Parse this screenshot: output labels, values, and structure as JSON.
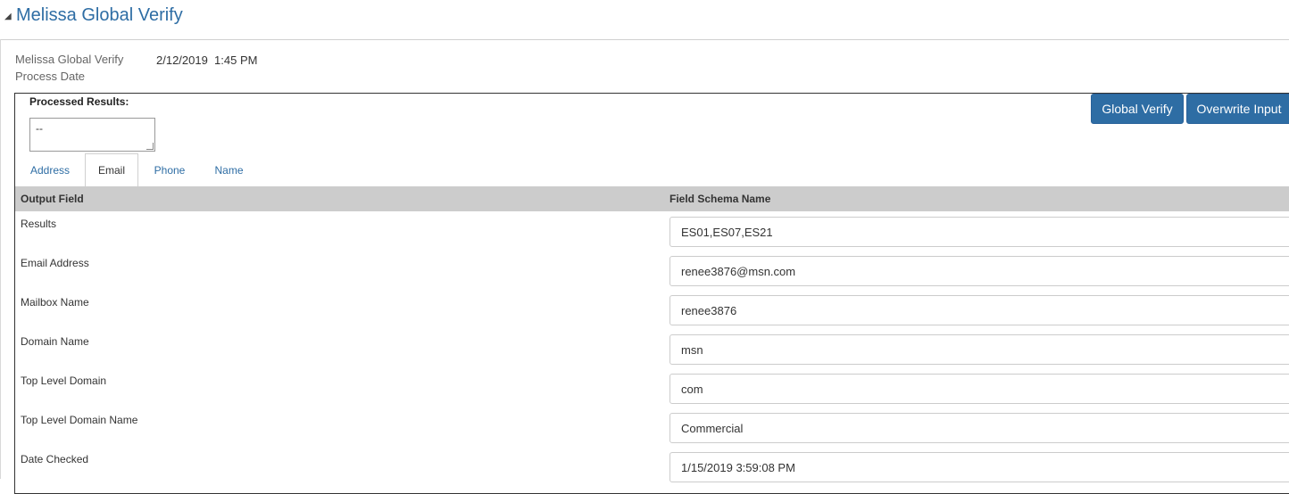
{
  "section": {
    "title": "Melissa Global Verify"
  },
  "process_date": {
    "label": "Melissa Global Verify Process Date",
    "value": "2/12/2019  1:45 PM"
  },
  "processed_results": {
    "label": "Processed Results:",
    "value": "--"
  },
  "buttons": {
    "global_verify": "Global Verify",
    "overwrite_input": "Overwrite Input"
  },
  "tabs": [
    {
      "label": "Address",
      "active": false
    },
    {
      "label": "Email",
      "active": true
    },
    {
      "label": "Phone",
      "active": false
    },
    {
      "label": "Name",
      "active": false
    }
  ],
  "grid": {
    "columns": [
      "Output Field",
      "Field Schema Name"
    ],
    "rows": [
      {
        "field": "Results",
        "value": "ES01,ES07,ES21"
      },
      {
        "field": "Email Address",
        "value": "renee3876@msn.com"
      },
      {
        "field": "Mailbox Name",
        "value": "renee3876"
      },
      {
        "field": "Domain Name",
        "value": "msn"
      },
      {
        "field": "Top Level Domain",
        "value": "com"
      },
      {
        "field": "Top Level Domain Name",
        "value": "Commercial"
      },
      {
        "field": "Date Checked",
        "value": "1/15/2019 3:59:08 PM"
      }
    ]
  },
  "colors": {
    "accent": "#2e6da4",
    "header_bg": "#cccccc"
  }
}
